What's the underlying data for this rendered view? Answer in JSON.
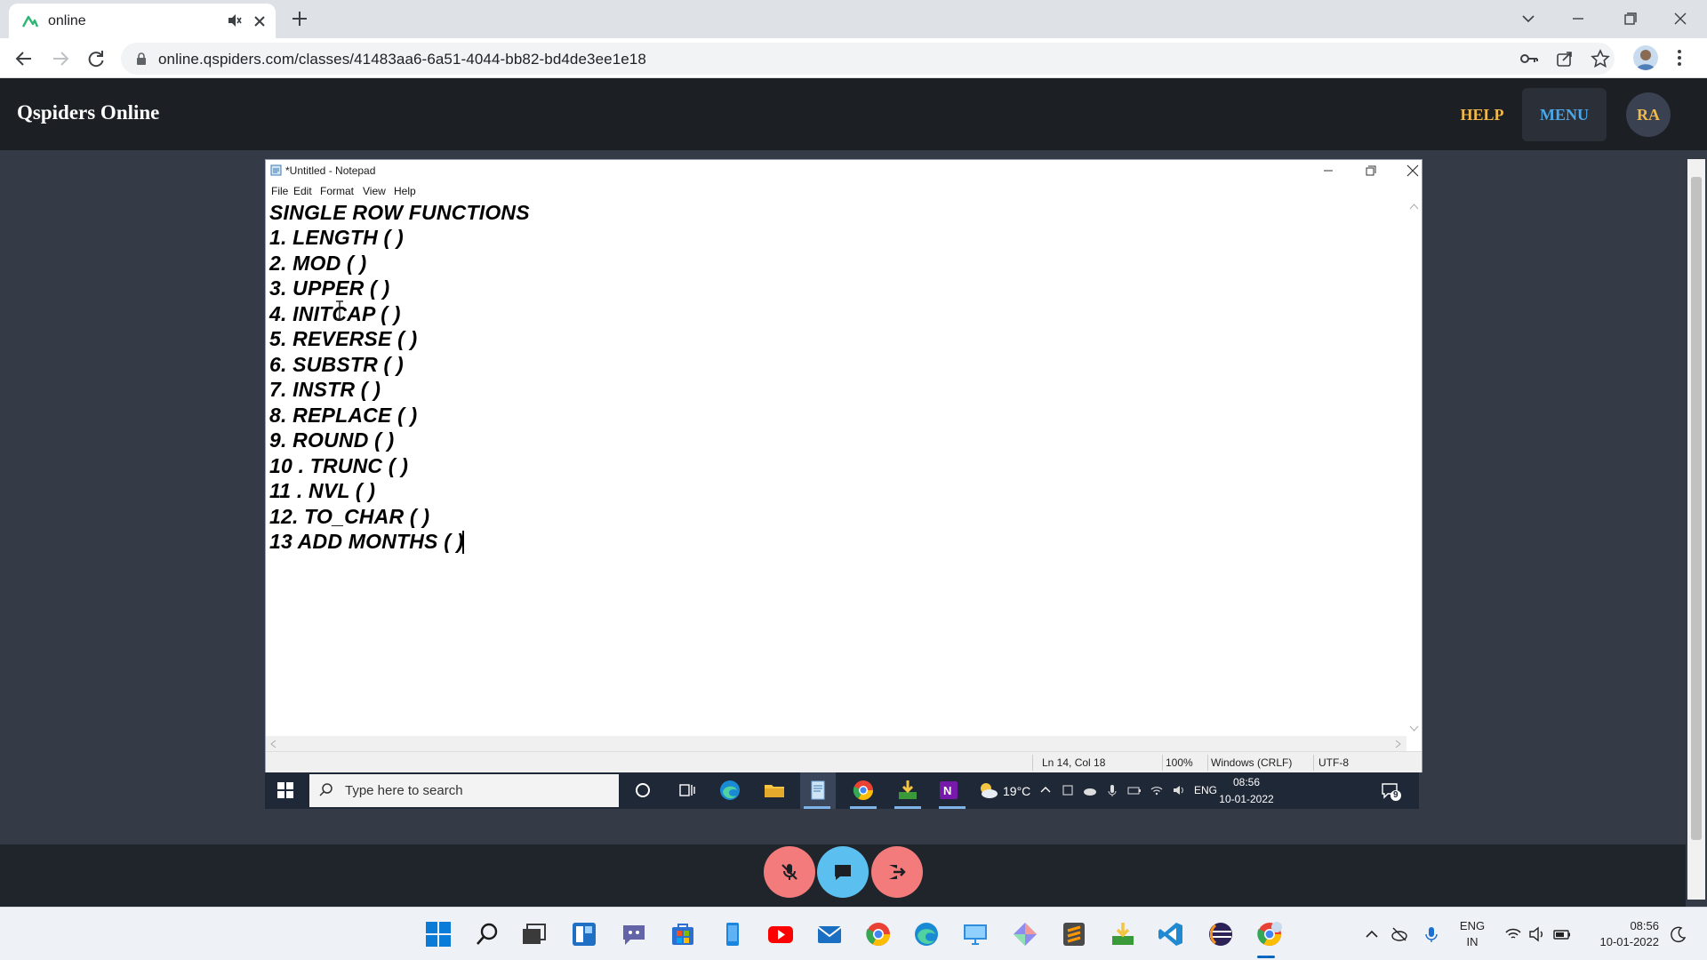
{
  "browser": {
    "tab_title": "online",
    "url": "online.qspiders.com/classes/41483aa6-6a51-4044-bb82-bd4de3ee1e18"
  },
  "app": {
    "brand": "Qspiders Online",
    "help_label": "HELP",
    "menu_label": "MENU",
    "avatar_initials": "RA",
    "colors": {
      "header_bg": "#1c1f24",
      "help": "#f1b94a",
      "menu": "#4aa8e8",
      "stage_bg": "#343b47"
    }
  },
  "notepad": {
    "title": "*Untitled - Notepad",
    "menu": [
      "File",
      "Edit",
      "Format",
      "View",
      "Help"
    ],
    "lines": [
      "SINGLE ROW FUNCTIONS",
      "1. LENGTH ( )",
      "2. MOD ( )",
      "3. UPPER ( )",
      "4. INITCAP ( )",
      "5. REVERSE ( )",
      "6. SUBSTR ( )",
      "7. INSTR ( )",
      "8. REPLACE ( )",
      "9. ROUND ( )",
      "10 . TRUNC ( )",
      "11 . NVL ( )",
      "12. TO_CHAR ( )",
      "13 ADD MONTHS ( )"
    ],
    "status": {
      "position": "Ln 14, Col 18",
      "zoom": "100%",
      "line_ending": "Windows (CRLF)",
      "encoding": "UTF-8"
    }
  },
  "shared_taskbar": {
    "search_placeholder": "Type here to search",
    "weather": "19°C",
    "language": "ENG",
    "time": "08:56",
    "date": "10-01-2022",
    "notification_count": "9"
  },
  "call_controls": {
    "mute_color": "#f37b7b",
    "chat_color": "#5bc0f0",
    "leave_color": "#f37b7b"
  },
  "system_taskbar": {
    "language_line1": "ENG",
    "language_line2": "IN",
    "time": "08:56",
    "date": "10-01-2022"
  }
}
